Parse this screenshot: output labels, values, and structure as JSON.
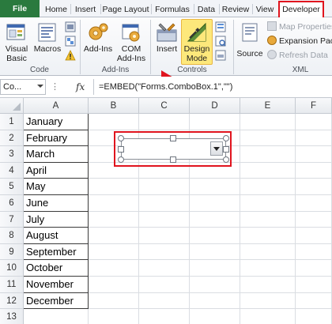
{
  "tabs": {
    "file": "File",
    "home": "Home",
    "insert": "Insert",
    "page_layout": "Page Layout",
    "formulas": "Formulas",
    "data": "Data",
    "review": "Review",
    "view": "View",
    "developer": "Developer"
  },
  "ribbon": {
    "code": {
      "label": "Code",
      "visual_basic": "Visual Basic",
      "visual_basic_line1": "Visual",
      "visual_basic_line2": "Basic",
      "macros": "Macros"
    },
    "addins": {
      "label": "Add-Ins",
      "add_ins": "Add-Ins",
      "com_line1": "COM",
      "com_line2": "Add-Ins"
    },
    "controls": {
      "label": "Controls",
      "insert": "Insert",
      "design_line1": "Design",
      "design_line2": "Mode"
    },
    "xml": {
      "label": "XML",
      "source": "Source",
      "map_properties": "Map Properties",
      "expansion_packs": "Expansion Pac",
      "refresh_data": "Refresh Data"
    }
  },
  "formula_bar": {
    "name_box": "Co...",
    "fx": "fx",
    "formula": "=EMBED(\"Forms.ComboBox.1\",\"\")"
  },
  "columns": [
    "A",
    "B",
    "C",
    "D",
    "E",
    "F"
  ],
  "rows": [
    "1",
    "2",
    "3",
    "4",
    "5",
    "6",
    "7",
    "8",
    "9",
    "10",
    "11",
    "12",
    "13"
  ],
  "months": [
    "January",
    "February",
    "March",
    "April",
    "May",
    "June",
    "July",
    "August",
    "September",
    "October",
    "November",
    "December"
  ],
  "colors": {
    "accent_red": "#e0141e",
    "file_tab": "#2a7a3e",
    "design_highlight": "#fde87b"
  }
}
